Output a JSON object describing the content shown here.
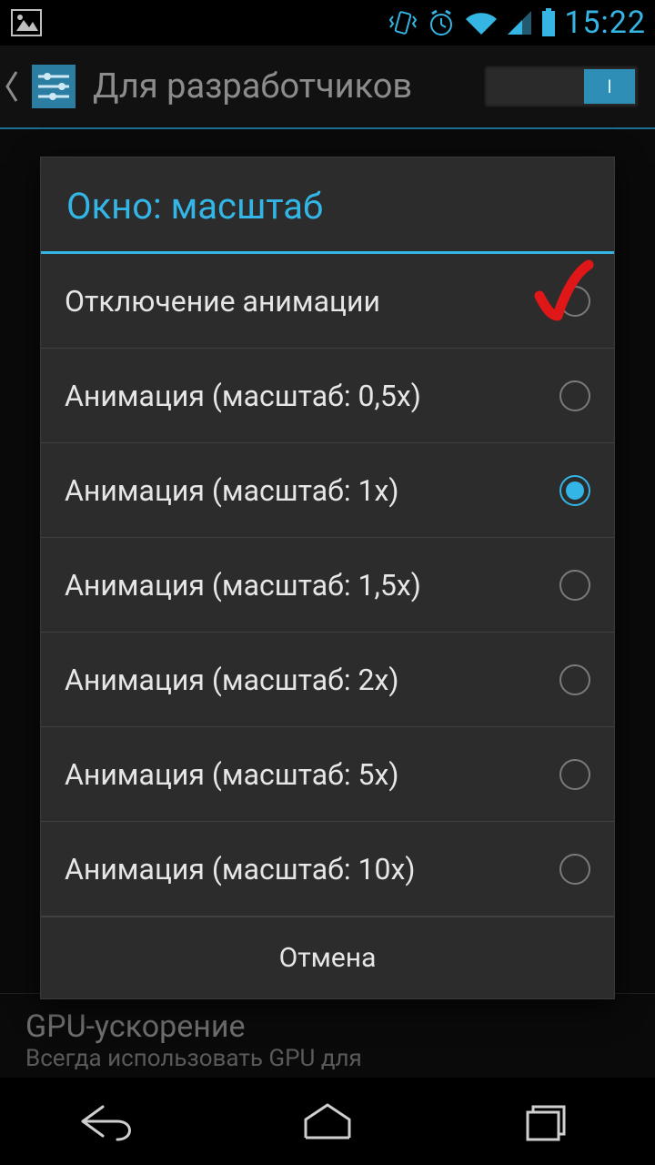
{
  "status": {
    "time": "15:22"
  },
  "actionbar": {
    "title": "Для разработчиков",
    "toggle_on_label": "I"
  },
  "background": {
    "gpu_title": "GPU-ускорение",
    "gpu_sub": "Всегда использовать GPU для"
  },
  "dialog": {
    "title": "Окно: масштаб",
    "options": [
      {
        "label": "Отключение анимации",
        "selected": false,
        "annotated": true
      },
      {
        "label": "Анимация (масштаб: 0,5x)",
        "selected": false,
        "annotated": false
      },
      {
        "label": "Анимация (масштаб: 1x)",
        "selected": true,
        "annotated": false
      },
      {
        "label": "Анимация (масштаб: 1,5x)",
        "selected": false,
        "annotated": false
      },
      {
        "label": "Анимация (масштаб: 2x)",
        "selected": false,
        "annotated": false
      },
      {
        "label": "Анимация (масштаб: 5x)",
        "selected": false,
        "annotated": false
      },
      {
        "label": "Анимация (масштаб: 10x)",
        "selected": false,
        "annotated": false
      }
    ],
    "cancel": "Отмена"
  }
}
